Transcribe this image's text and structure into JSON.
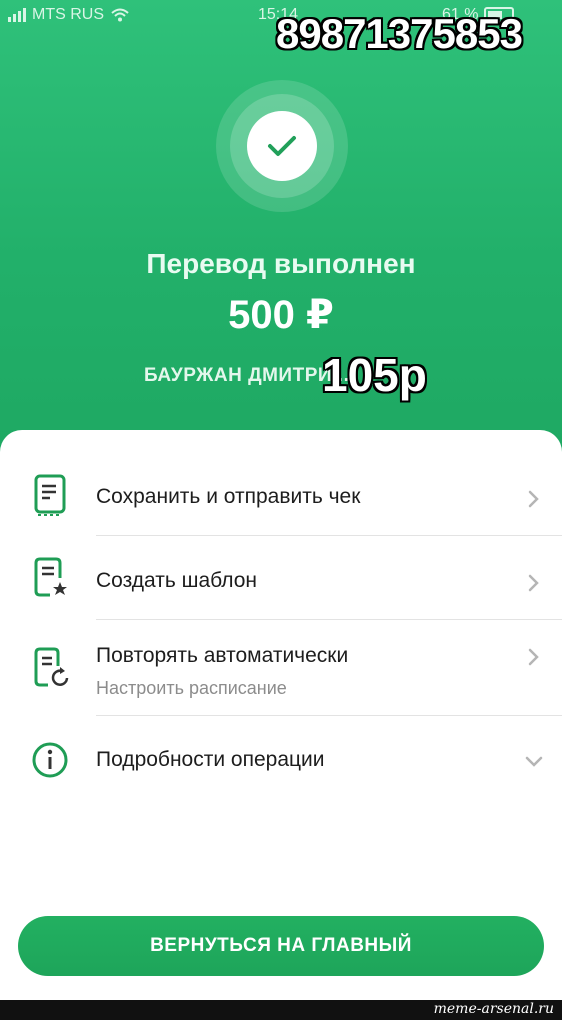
{
  "status_bar": {
    "carrier": "MTS RUS",
    "time": "15:14",
    "battery_percent": "61 %"
  },
  "overlay": {
    "phone": "89871375853",
    "price": "105р"
  },
  "result": {
    "title": "Перевод выполнен",
    "amount": "500 ₽",
    "recipient": "БАУРЖАН ДМИТРИ..."
  },
  "actions": [
    {
      "label": "Сохранить и отправить чек",
      "icon": "receipt-icon"
    },
    {
      "label": "Создать шаблон",
      "icon": "template-star-icon"
    },
    {
      "label": "Повторять автоматически",
      "sublabel": "Настроить расписание",
      "icon": "repeat-schedule-icon"
    },
    {
      "label": "Подробности операции",
      "icon": "info-icon"
    }
  ],
  "cta": {
    "label": "ВЕРНУТЬСЯ НА ГЛАВНЫЙ"
  },
  "watermark": "meme-arsenal.ru",
  "colors": {
    "brand_green": "#21a05a",
    "icon_green": "#1f9d55",
    "chevron_gray": "#b5b5b5"
  }
}
